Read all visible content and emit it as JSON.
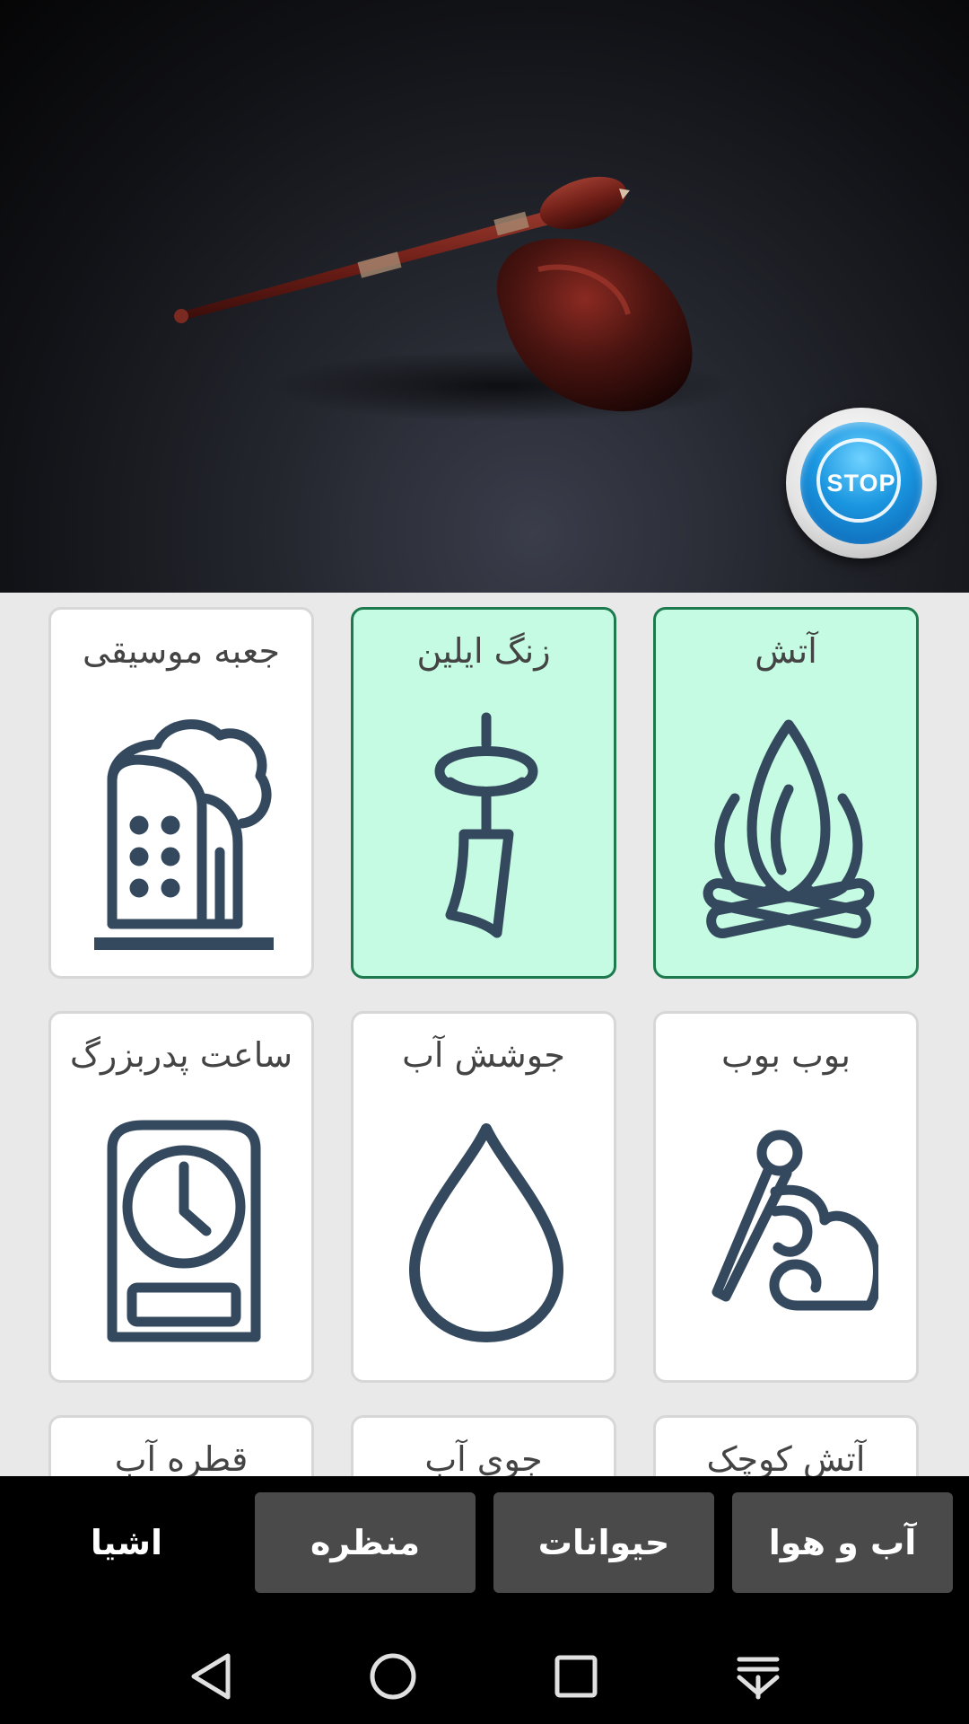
{
  "hero": {
    "stop_button": {
      "label": "STOP"
    }
  },
  "grid": {
    "cards": [
      {
        "label": "آتش",
        "icon": "campfire-icon",
        "active": true
      },
      {
        "label": "زنگ ایلین",
        "icon": "wind-chime-icon",
        "active": true
      },
      {
        "label": "جعبه موسیقی",
        "icon": "music-box-icon",
        "active": false
      },
      {
        "label": "بوب بوب",
        "icon": "bob-bob-icon",
        "active": false
      },
      {
        "label": "جوشش آب",
        "icon": "water-drop-icon",
        "active": false
      },
      {
        "label": "ساعت پدربزرگ",
        "icon": "grandfather-clock-icon",
        "active": false
      },
      {
        "label": "آتش کوچک",
        "icon": "small-fire-icon",
        "active": false
      },
      {
        "label": "جوی آب",
        "icon": "stream-icon",
        "active": false
      },
      {
        "label": "قطره آب",
        "icon": "water-drop-icon",
        "active": false
      }
    ]
  },
  "tabs": [
    {
      "label": "آب و هوا",
      "selected": false
    },
    {
      "label": "حیوانات",
      "selected": false
    },
    {
      "label": "منظره",
      "selected": false
    },
    {
      "label": "اشیا",
      "selected": true
    }
  ],
  "navbar": {
    "icons": [
      "back-icon",
      "home-icon",
      "recents-icon",
      "notifications-pull-icon"
    ]
  },
  "colors": {
    "active_card_bg": "#c4fbe2",
    "active_card_border": "#1d7a4e",
    "icon_stroke": "#34495e",
    "tab_bg": "#4a4a4a"
  }
}
